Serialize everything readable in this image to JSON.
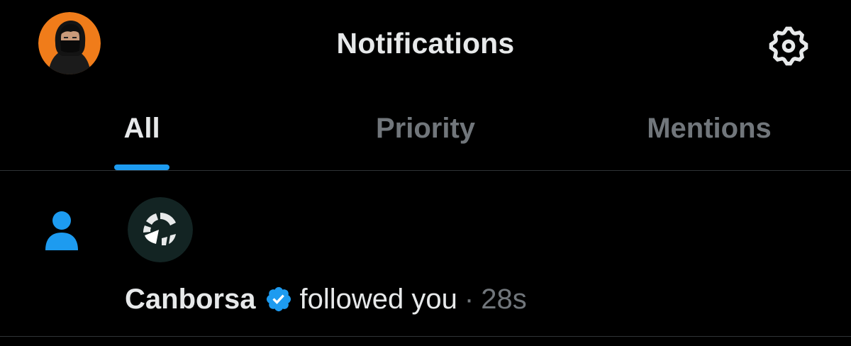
{
  "header": {
    "title": "Notifications",
    "avatar_icon": "user-avatar-ninja",
    "settings_icon": "gear-icon"
  },
  "tabs": [
    {
      "label": "All",
      "active": true
    },
    {
      "label": "Priority",
      "active": false
    },
    {
      "label": "Mentions",
      "active": false
    }
  ],
  "notifications": [
    {
      "type_icon": "person-icon",
      "user_name": "Canborsa",
      "verified": true,
      "action": "followed you",
      "separator": "·",
      "time": "28s"
    }
  ],
  "colors": {
    "background": "#000000",
    "accent": "#1d9bf0",
    "primary_text": "#e7e9ea",
    "secondary_text": "#71767b",
    "divider": "#2f3336",
    "avatar_bg": "#f07c1a"
  }
}
